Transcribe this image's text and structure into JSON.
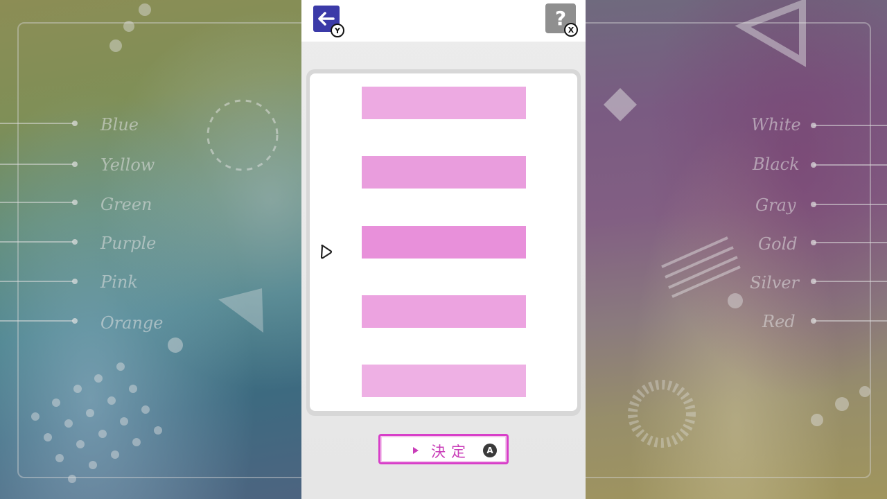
{
  "left_colors": [
    "Blue",
    "Yellow",
    "Green",
    "Purple",
    "Pink",
    "Orange"
  ],
  "right_colors": [
    "White",
    "Black",
    "Gray",
    "Gold",
    "Silver",
    "Red"
  ],
  "header": {
    "back_icon": "arrow-left-icon",
    "back_badge": "Y",
    "help_label": "?",
    "help_badge": "X"
  },
  "swatches": [
    {
      "color": "#edaae2"
    },
    {
      "color": "#e99ddd"
    },
    {
      "color": "#e890da"
    },
    {
      "color": "#eca3e0"
    },
    {
      "color": "#eeb0e4"
    }
  ],
  "selected_index": 2,
  "confirm": {
    "label": "決定",
    "badge": "A",
    "accent": "#d83fc9"
  }
}
